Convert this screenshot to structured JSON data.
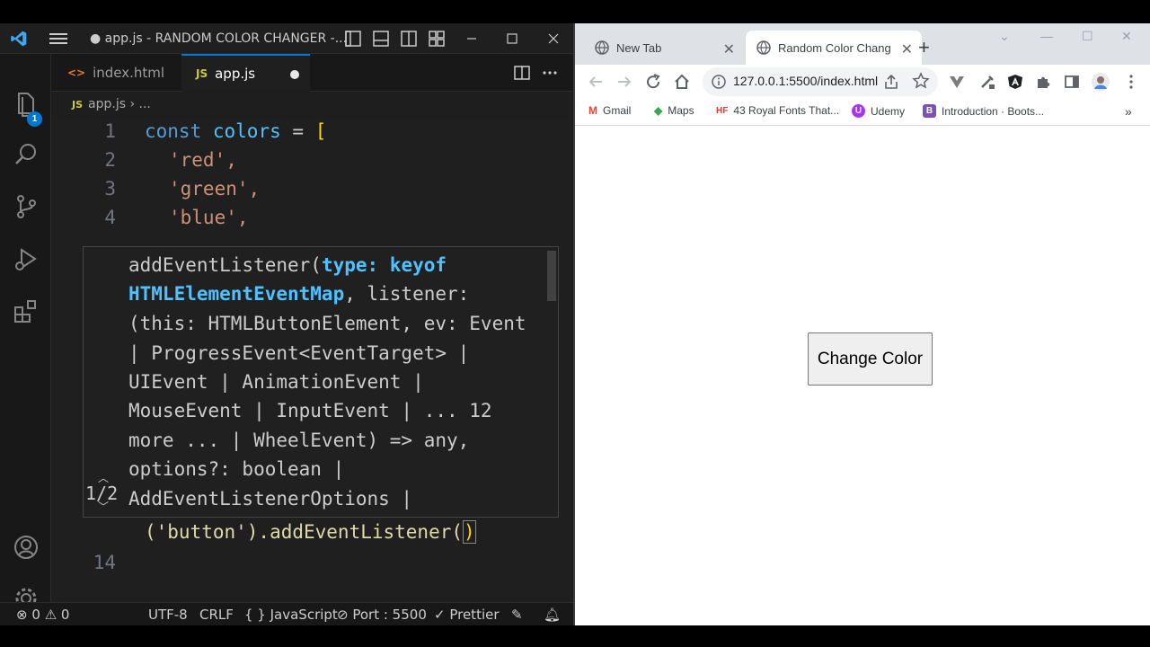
{
  "vscode": {
    "window_title": "● app.js - RANDOM COLOR CHANGER -...",
    "explorer_badge": "1",
    "tabs": [
      {
        "label": "index.html",
        "icon": "html-icon"
      },
      {
        "label": "app.js",
        "icon": "JS"
      }
    ],
    "breadcrumb": {
      "file": "app.js",
      "sep": "›",
      "rest": "..."
    },
    "code_lines": [
      {
        "num": "1",
        "text": "const colors = ["
      },
      {
        "num": "2",
        "text": "'red',"
      },
      {
        "num": "3",
        "text": "'green',"
      },
      {
        "num": "4",
        "text": "'blue',"
      },
      {
        "num": "14",
        "text": ""
      }
    ],
    "current_line": {
      "text_pre": "('button').addEventListener(",
      "text_post": ")"
    },
    "hover": {
      "lines": [
        "addEventListener(",
        "type: keyof",
        "HTMLElementEventMap",
        ", listener:",
        "(this: HTMLButtonElement, ev: Event",
        "| ProgressEvent<EventTarget> |",
        "UIEvent | AnimationEvent |",
        "MouseEvent | InputEvent | ... 12",
        "more ... | WheelEvent) => any,",
        "options?: boolean |",
        "AddEventListenerOptions |"
      ],
      "pager": "1/2"
    },
    "status": {
      "errors": "0",
      "warnings": "0",
      "encoding": "UTF-8",
      "eol": "CRLF",
      "language": "{ } JavaScript",
      "port": "Port : 5500",
      "prettier": "✓ Prettier"
    }
  },
  "chrome": {
    "tabs": [
      {
        "label": "New Tab"
      },
      {
        "label": "Random Color Chang"
      }
    ],
    "url": "127.0.0.1:5500/index.html",
    "bookmarks": [
      {
        "label": "Gmail",
        "icon": "M"
      },
      {
        "label": "Maps",
        "icon": "◆"
      },
      {
        "label": "43 Royal Fonts That...",
        "icon": "HF"
      },
      {
        "label": "Udemy",
        "icon": "U"
      },
      {
        "label": "Introduction · Boots...",
        "icon": "B"
      }
    ],
    "bookmarks_more": "»",
    "page": {
      "button_label": "Change Color"
    }
  },
  "colors": {
    "vscode_bg": "#1f1f1f",
    "keyword": "#569cd6",
    "variable": "#4fc1ff",
    "string": "#ce9178",
    "bracket": "#ffd700",
    "accent": "#0078d4"
  }
}
